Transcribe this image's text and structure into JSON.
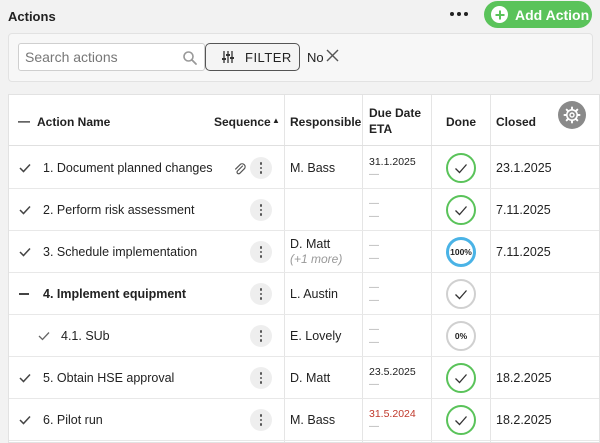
{
  "header": {
    "title": "Actions",
    "add_label": "Add Action",
    "accent": "#5ac35a"
  },
  "filters": {
    "search_placeholder": "Search actions",
    "filter_label": "FILTER",
    "active_filter": "No"
  },
  "table": {
    "columns": {
      "name": "Action Name",
      "sequence": "Sequence",
      "sort_indicator": "▲",
      "responsible": "Responsible",
      "due_line1": "Due Date",
      "due_line2": "ETA",
      "done": "Done",
      "closed": "Closed"
    },
    "collapse_all_symbol": "—",
    "dash": "—",
    "rows": [
      {
        "name": "1. Document planned changes",
        "responsible": "M. Bass",
        "due": "31.1.2025",
        "eta": "—",
        "done": "check",
        "done_color": "#5ac35a",
        "closed": "23.1.2025",
        "attachment": true
      },
      {
        "name": "2. Perform risk assessment",
        "responsible": "",
        "due": "—",
        "eta": "—",
        "done": "check",
        "done_color": "#5ac35a",
        "closed": "7.11.2025"
      },
      {
        "name": "3. Schedule implementation",
        "responsible": "D. Matt",
        "responsible_more": "(+1 more)",
        "due": "—",
        "eta": "—",
        "done": "100%",
        "done_color": "#4ab3e6",
        "closed": "7.11.2025"
      },
      {
        "name": "4. Implement equipment",
        "responsible": "L. Austin",
        "due": "—",
        "eta": "—",
        "done": "check",
        "done_color": "#cccccc",
        "closed": "",
        "expanded": true
      },
      {
        "name": "4.1. SUb",
        "responsible": "E. Lovely",
        "due": "—",
        "eta": "—",
        "done": "0%",
        "done_color": "#cccccc",
        "closed": "",
        "child": true
      },
      {
        "name": "5. Obtain HSE approval",
        "responsible": "D. Matt",
        "due": "23.5.2025",
        "eta": "—",
        "done": "check",
        "done_color": "#5ac35a",
        "closed": "18.2.2025"
      },
      {
        "name": "6. Pilot run",
        "responsible": "M. Bass",
        "due": "31.5.2024",
        "due_overdue": true,
        "eta": "—",
        "done": "check",
        "done_color": "#5ac35a",
        "closed": "18.2.2025"
      }
    ]
  }
}
